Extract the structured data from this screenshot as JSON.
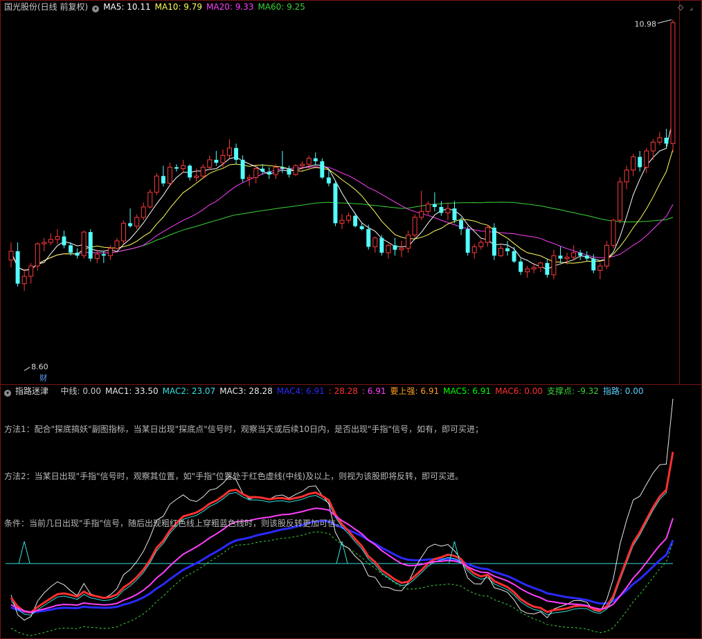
{
  "header_main": {
    "stock": "国光股份(日线 前复权)",
    "ma5": "MA5: 10.11",
    "ma10": "MA10: 9.79",
    "ma20": "MA20: 9.33",
    "ma60": "MA60: 9.25",
    "high_label": "10.98",
    "low_label": "8.60",
    "cai_badge": "财"
  },
  "header_sub": {
    "indicator": "指路迷津",
    "zx": "中线: 0.00",
    "mac1": "MAC1: 33.50",
    "mac2": "MAC2: 23.07",
    "mac3": "MAC3: 28.28",
    "mac4": "MAC4: 6.91",
    "v1": ": 28.28",
    "v2": ": 6.91",
    "yao": "要上强: 6.91",
    "mac5": "MAC5: 6.91",
    "mac6": "MAC6: 0.00",
    "zcd": "支撑点: -9.32",
    "zl": "指路: 0.00"
  },
  "notes": [
    "方法1：配合\"探底搞妖\"副图指标，当某日出现\"探底点\"信号时，观察当天或后续10日内，是否出现\"手指\"信号，如有，即可买进；",
    "方法2：当某日出现\"手指\"信号时，观察其位置，如\"手指\"位置处于红色虚线(中线)及以上，则视为该股即将反转，即可买进。",
    "条件：当前几日出现\"手指\"信号，随后出现粗红色线上穿粗蓝色线时，则该股反转更加可信。"
  ],
  "colors": {
    "up": "#ff3b3b",
    "down": "#54ffff",
    "ma5": "#ffffff",
    "ma10": "#ffff5a",
    "ma20": "#ff40ff",
    "ma60": "#39d439",
    "mac2": "#38e0e0",
    "mac4": "#2a2aff",
    "mac5": "#00ff00",
    "mac6": "#ff3030"
  },
  "chart_data": [
    {
      "type": "candlestick",
      "title": "国光股份(日线 前复权)",
      "ohlc": [
        [
          9.35,
          9.47,
          9.3,
          9.41
        ],
        [
          9.41,
          9.47,
          9.17,
          9.19
        ],
        [
          9.19,
          9.29,
          9.14,
          9.24
        ],
        [
          9.24,
          9.33,
          9.19,
          9.31
        ],
        [
          9.31,
          9.47,
          9.28,
          9.46
        ],
        [
          9.46,
          9.5,
          9.41,
          9.47
        ],
        [
          9.47,
          9.53,
          9.45,
          9.49
        ],
        [
          9.49,
          9.56,
          9.46,
          9.51
        ],
        [
          9.51,
          9.55,
          9.43,
          9.45
        ],
        [
          9.45,
          9.47,
          9.38,
          9.4
        ],
        [
          9.4,
          9.43,
          9.36,
          9.38
        ],
        [
          9.38,
          9.55,
          9.36,
          9.54
        ],
        [
          9.54,
          9.56,
          9.34,
          9.36
        ],
        [
          9.36,
          9.42,
          9.33,
          9.39
        ],
        [
          9.39,
          9.41,
          9.33,
          9.38
        ],
        [
          9.38,
          9.45,
          9.35,
          9.43
        ],
        [
          9.43,
          9.5,
          9.42,
          9.48
        ],
        [
          9.48,
          9.62,
          9.46,
          9.6
        ],
        [
          9.6,
          9.7,
          9.57,
          9.58
        ],
        [
          9.58,
          9.66,
          9.56,
          9.64
        ],
        [
          9.64,
          9.74,
          9.62,
          9.71
        ],
        [
          9.71,
          9.83,
          9.7,
          9.81
        ],
        [
          9.81,
          9.94,
          9.79,
          9.92
        ],
        [
          9.92,
          9.99,
          9.85,
          9.87
        ],
        [
          9.87,
          10.01,
          9.85,
          9.98
        ],
        [
          9.98,
          10.0,
          9.95,
          9.97
        ],
        [
          9.97,
          10.03,
          9.94,
          9.99
        ],
        [
          9.99,
          10.0,
          9.89,
          9.91
        ],
        [
          9.91,
          9.97,
          9.88,
          9.92
        ],
        [
          9.92,
          10.0,
          9.9,
          9.98
        ],
        [
          9.98,
          10.06,
          9.96,
          10.03
        ],
        [
          10.03,
          10.09,
          9.99,
          10.01
        ],
        [
          10.01,
          10.1,
          9.98,
          10.06
        ],
        [
          10.06,
          10.17,
          10.04,
          10.11
        ],
        [
          10.11,
          10.14,
          10.0,
          10.03
        ],
        [
          10.03,
          10.06,
          9.88,
          9.9
        ],
        [
          9.9,
          9.93,
          9.85,
          9.91
        ],
        [
          9.91,
          9.99,
          9.87,
          9.97
        ],
        [
          9.97,
          10.0,
          9.93,
          9.95
        ],
        [
          9.95,
          9.98,
          9.9,
          9.93
        ],
        [
          9.93,
          10.0,
          9.9,
          9.98
        ],
        [
          9.98,
          10.09,
          9.94,
          9.97
        ],
        [
          9.97,
          9.99,
          9.91,
          9.93
        ],
        [
          9.93,
          10.0,
          9.92,
          9.99
        ],
        [
          9.99,
          10.02,
          9.96,
          10.0
        ],
        [
          10.0,
          10.06,
          9.96,
          10.04
        ],
        [
          10.04,
          10.08,
          9.99,
          10.02
        ],
        [
          10.02,
          10.04,
          9.9,
          9.91
        ],
        [
          9.91,
          9.96,
          9.85,
          9.87
        ],
        [
          9.87,
          9.89,
          9.58,
          9.6
        ],
        [
          9.6,
          9.66,
          9.56,
          9.62
        ],
        [
          9.62,
          9.67,
          9.6,
          9.65
        ],
        [
          9.65,
          9.67,
          9.57,
          9.58
        ],
        [
          9.58,
          9.6,
          9.55,
          9.56
        ],
        [
          9.56,
          9.59,
          9.42,
          9.44
        ],
        [
          9.44,
          9.51,
          9.4,
          9.5
        ],
        [
          9.5,
          9.52,
          9.38,
          9.4
        ],
        [
          9.4,
          9.46,
          9.36,
          9.45
        ],
        [
          9.45,
          9.5,
          9.38,
          9.42
        ],
        [
          9.42,
          9.48,
          9.37,
          9.43
        ],
        [
          9.43,
          9.55,
          9.4,
          9.52
        ],
        [
          9.52,
          9.66,
          9.5,
          9.64
        ],
        [
          9.64,
          9.82,
          9.62,
          9.68
        ],
        [
          9.68,
          9.75,
          9.66,
          9.73
        ],
        [
          9.73,
          9.81,
          9.68,
          9.71
        ],
        [
          9.71,
          9.75,
          9.65,
          9.67
        ],
        [
          9.67,
          9.74,
          9.62,
          9.7
        ],
        [
          9.7,
          9.75,
          9.6,
          9.62
        ],
        [
          9.62,
          9.64,
          9.52,
          9.56
        ],
        [
          9.56,
          9.58,
          9.38,
          9.4
        ],
        [
          9.4,
          9.46,
          9.36,
          9.44
        ],
        [
          9.44,
          9.49,
          9.42,
          9.47
        ],
        [
          9.47,
          9.59,
          9.44,
          9.57
        ],
        [
          9.57,
          9.6,
          9.35,
          9.38
        ],
        [
          9.38,
          9.45,
          9.37,
          9.43
        ],
        [
          9.43,
          9.48,
          9.38,
          9.41
        ],
        [
          9.41,
          9.44,
          9.33,
          9.34
        ],
        [
          9.34,
          9.36,
          9.25,
          9.27
        ],
        [
          9.27,
          9.31,
          9.23,
          9.29
        ],
        [
          9.29,
          9.33,
          9.26,
          9.3
        ],
        [
          9.3,
          9.34,
          9.27,
          9.33
        ],
        [
          9.33,
          9.36,
          9.23,
          9.25
        ],
        [
          9.25,
          9.42,
          9.22,
          9.38
        ],
        [
          9.38,
          9.44,
          9.33,
          9.36
        ],
        [
          9.36,
          9.4,
          9.32,
          9.37
        ],
        [
          9.37,
          9.45,
          9.35,
          9.4
        ],
        [
          9.4,
          9.42,
          9.35,
          9.38
        ],
        [
          9.38,
          9.41,
          9.34,
          9.36
        ],
        [
          9.36,
          9.39,
          9.26,
          9.28
        ],
        [
          9.28,
          9.33,
          9.22,
          9.31
        ],
        [
          9.31,
          9.48,
          9.29,
          9.45
        ],
        [
          9.45,
          9.63,
          9.43,
          9.62
        ],
        [
          9.62,
          9.91,
          9.6,
          9.88
        ],
        [
          9.88,
          9.99,
          9.83,
          9.96
        ],
        [
          9.96,
          10.07,
          9.92,
          10.05
        ],
        [
          10.05,
          10.09,
          9.95,
          9.98
        ],
        [
          9.98,
          10.11,
          9.94,
          10.09
        ],
        [
          10.09,
          10.17,
          10.03,
          10.15
        ],
        [
          10.15,
          10.22,
          10.13,
          10.18
        ],
        [
          10.18,
          10.24,
          10.11,
          10.14
        ],
        [
          10.14,
          10.98,
          10.08,
          10.96
        ]
      ],
      "ylim": [
        8.55,
        11.02
      ],
      "high_marker": 10.98,
      "low_marker": 8.6
    }
  ]
}
